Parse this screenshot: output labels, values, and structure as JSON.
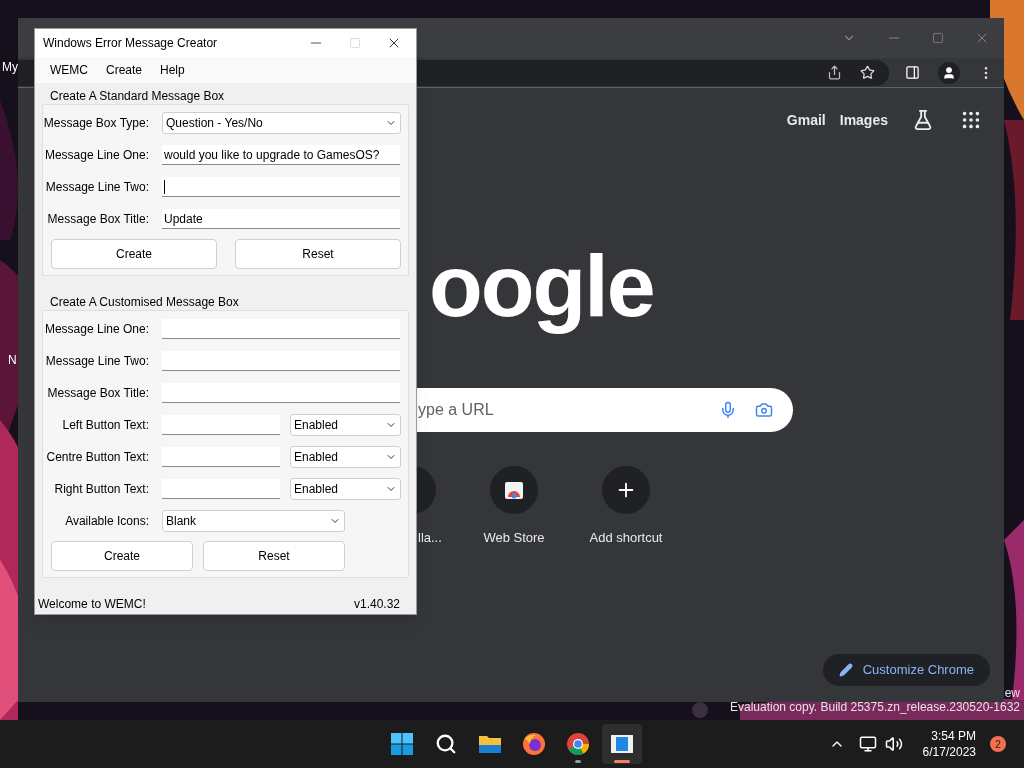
{
  "desktop": {
    "icon_labels": [
      "My",
      "N"
    ],
    "build_info": [
      "ew",
      "Evaluation copy. Build 25375.zn_release.230520-1632"
    ]
  },
  "browser": {
    "links": [
      "Gmail",
      "Images"
    ],
    "logo": "oogle",
    "search": {
      "placeholder": "ype a URL"
    },
    "shortcuts": [
      {
        "label": "lla...",
        "kind": "partial"
      },
      {
        "label": "Web Store",
        "kind": "store"
      },
      {
        "label": "Add shortcut",
        "kind": "add"
      }
    ],
    "customize_button": "Customize Chrome"
  },
  "app_window": {
    "title": "Windows Error Message Creator",
    "menu": [
      "WEMC",
      "Create",
      "Help"
    ],
    "standard": {
      "title": "Create A Standard Message Box",
      "fields": [
        {
          "label": "Message Box Type:",
          "kind": "dropdown",
          "value": "Question - Yes/No"
        },
        {
          "label": "Message Line One:",
          "kind": "text",
          "value": "would you like to upgrade to GamesOS?",
          "focused": false
        },
        {
          "label": "Message Line Two:",
          "kind": "text",
          "focused": true
        },
        {
          "label": "Message Box Title:",
          "kind": "text",
          "value": "Update",
          "focused": false
        }
      ],
      "buttons": [
        "Create",
        "Reset"
      ]
    },
    "custom": {
      "title": "Create A Customised Message Box",
      "fields": [
        {
          "label": "Message Line One:",
          "kind": "text",
          "focused": false
        },
        {
          "label": "Message Line Two:",
          "kind": "text",
          "focused": false
        },
        {
          "label": "Message Box Title:",
          "kind": "text",
          "focused": false
        },
        {
          "label": "Left Button Text:",
          "kind": "text_state",
          "state": "Enabled",
          "focused": false
        },
        {
          "label": "Centre Button Text:",
          "kind": "text_state",
          "state": "Enabled",
          "focused": false
        },
        {
          "label": "Right Button Text:",
          "kind": "text_state",
          "state": "Enabled",
          "focused": false
        },
        {
          "label": "Available Icons:",
          "kind": "short_dropdown",
          "value": "Blank"
        }
      ],
      "buttons": [
        "Create",
        "Reset"
      ]
    },
    "status_bar": {
      "message": "Welcome to WEMC!",
      "version": "v1.40.32"
    }
  },
  "taskbar": {
    "apps": [
      {
        "kind": "start",
        "running": false,
        "active": false
      },
      {
        "kind": "search",
        "running": false,
        "active": false
      },
      {
        "kind": "files",
        "running": false,
        "active": false
      },
      {
        "kind": "firefox",
        "running": false,
        "active": false
      },
      {
        "kind": "chrome",
        "running": true,
        "active": false
      },
      {
        "kind": "wemc",
        "running": true,
        "active": true
      }
    ],
    "time": "3:54 PM",
    "date": "6/17/2023",
    "notifications": "2"
  }
}
